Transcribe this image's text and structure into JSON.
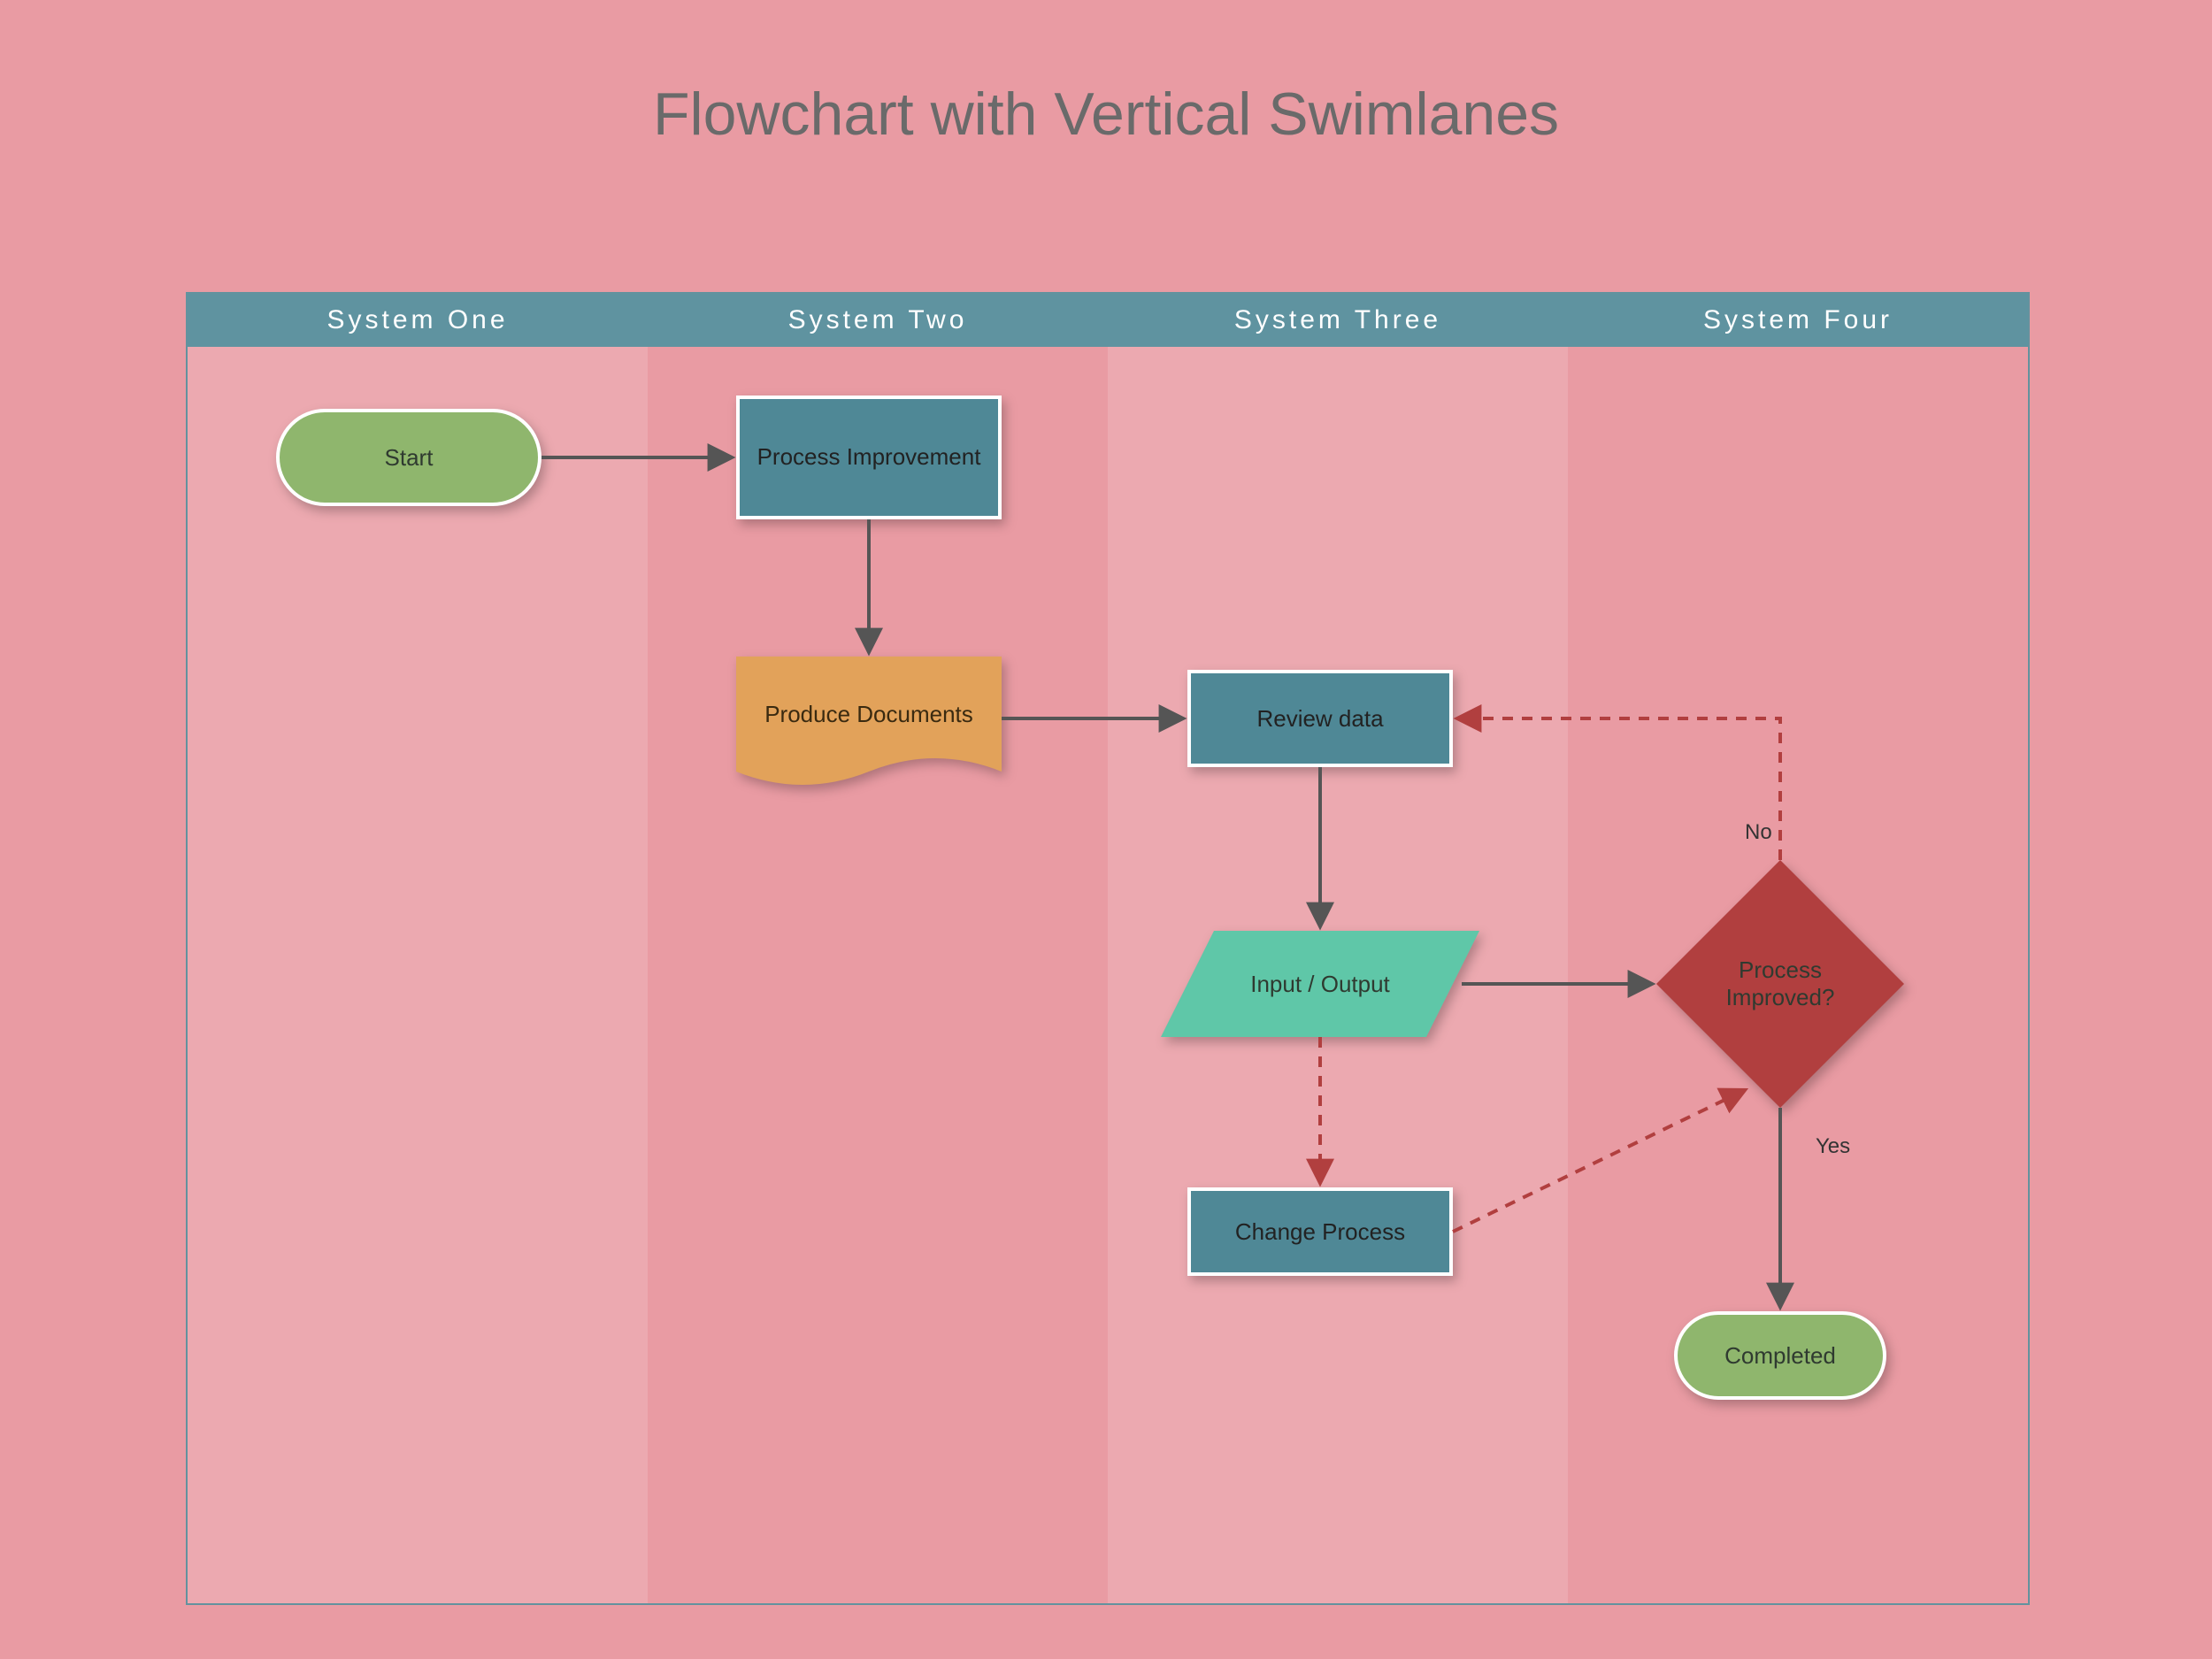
{
  "title": "Flowchart with Vertical Swimlanes",
  "lanes": [
    {
      "label": "System One"
    },
    {
      "label": "System Two"
    },
    {
      "label": "System Three"
    },
    {
      "label": "System Four"
    }
  ],
  "nodes": {
    "start": {
      "label": "Start"
    },
    "process_improvement": {
      "label": "Process Improvement"
    },
    "produce_documents": {
      "label": "Produce Documents"
    },
    "review_data": {
      "label": "Review data"
    },
    "input_output": {
      "label": "Input / Output"
    },
    "change_process": {
      "label": "Change Process"
    },
    "decision": {
      "label": "Process Improved?",
      "no": "No",
      "yes": "Yes"
    },
    "completed": {
      "label": "Completed"
    }
  },
  "colors": {
    "lane_header": "#5f93a0",
    "terminator": "#8fb66d",
    "process": "#4f8896",
    "document": "#e2a25a",
    "io": "#5fc7a8",
    "decision": "#b13f3f",
    "background": "#e99ba3"
  }
}
